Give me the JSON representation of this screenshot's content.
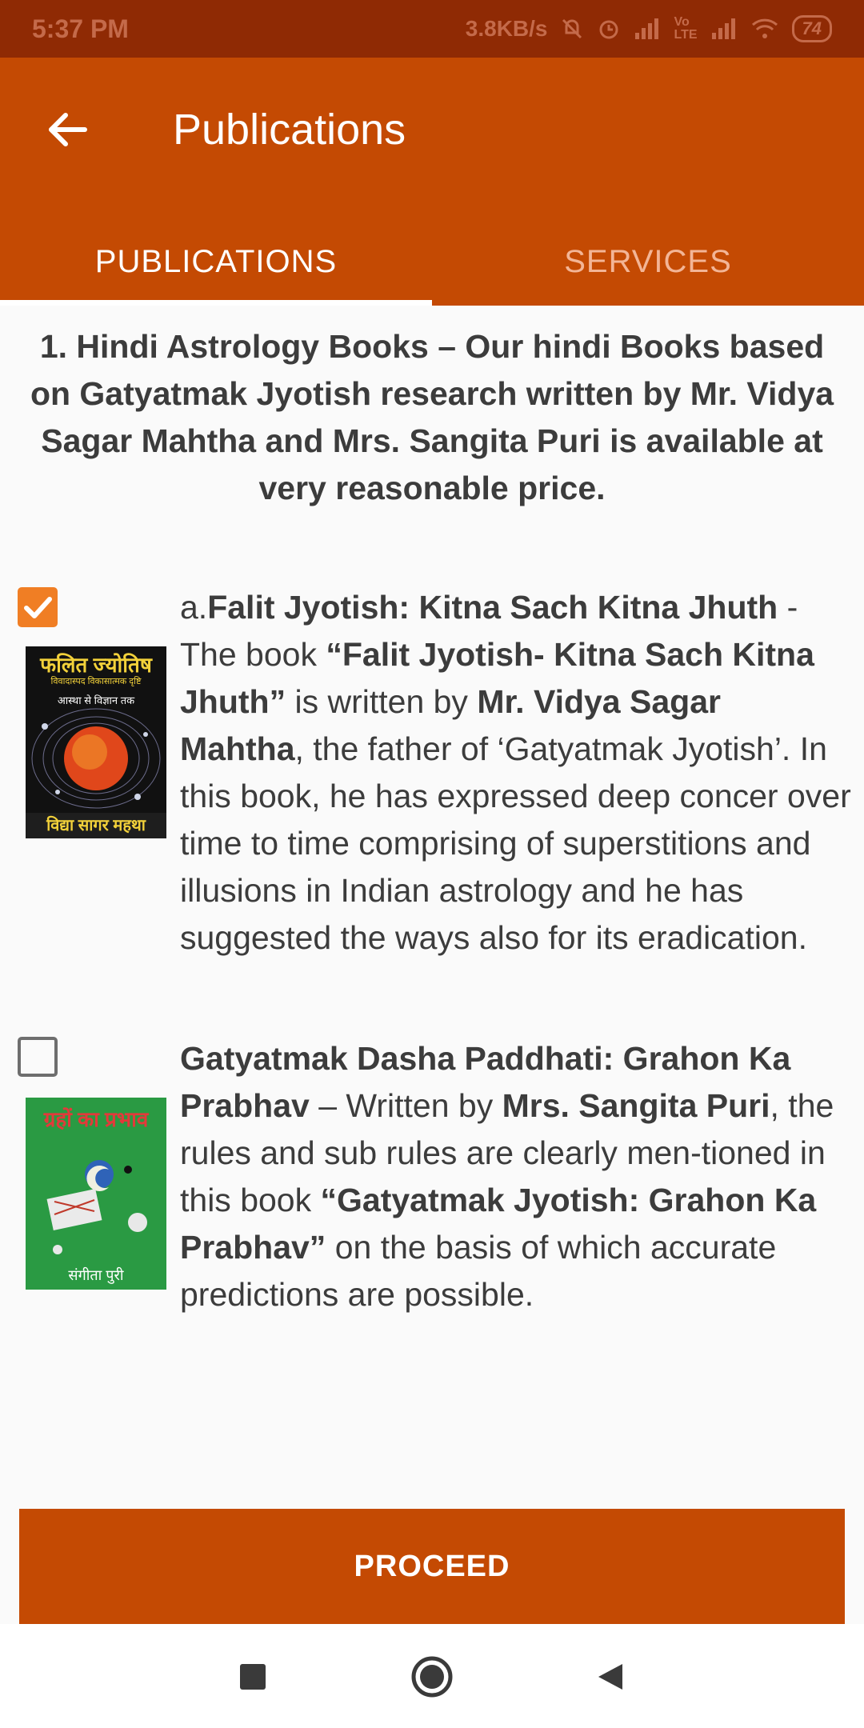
{
  "status_bar": {
    "time": "5:37 PM",
    "net_speed": "3.8KB/s",
    "battery": "74",
    "icons": [
      "mute-icon",
      "alarm-icon",
      "signal-icon",
      "volte-icon",
      "signal-icon",
      "wifi-icon",
      "battery-icon"
    ]
  },
  "app_bar": {
    "title": "Publications",
    "back_icon": "arrow-back-icon"
  },
  "tabs": [
    {
      "label": "PUBLICATIONS",
      "active": true
    },
    {
      "label": "SERVICES",
      "active": false
    }
  ],
  "intro": "1. Hindi Astrology Books – Our hindi Books based on Gatyatmak Jyotish research written by Mr. Vidya Sagar Mahtha and Mrs. Sangita Puri is available at very reasonable price.",
  "books": [
    {
      "checked": true,
      "cover": {
        "title": "फलित ज्योतिष",
        "subtitle": "विवादास्पद विकासात्मक दृष्टि",
        "tagline": "आस्था से विज्ञान तक",
        "author": "विद्या सागर महथा"
      },
      "prefix": "a.",
      "title": "Falit Jyotish: Kitna Sach Kitna Jhuth",
      "t1": " - The book ",
      "quote": "“Falit Jyotish- Kitna Sach Kitna Jhuth”",
      "t2": " is written by ",
      "author": "Mr. Vidya Sagar Mahtha",
      "t3": ", the father of ‘Gatyatmak Jyotish’. In this book, he has expressed deep concer over time to time comprising of superstitions and illusions in Indian astrology and he has suggested the ways also for its eradication."
    },
    {
      "checked": false,
      "cover": {
        "title": "ग्रहों का प्रभाव",
        "author": "संगीता पुरी"
      },
      "title": "Gatyatmak Dasha Paddhati: Grahon Ka Prabhav",
      "t1": " – Written by ",
      "author": "Mrs. Sangita Puri",
      "t2": ", the rules and sub rules are clearly men-tioned in this book ",
      "quote": "“Gatyatmak Jyotish: Grahon Ka Prabhav”",
      "t3": " on the basis of which accurate predictions are possible."
    }
  ],
  "proceed_label": "PROCEED",
  "nav": [
    "recent-apps-icon",
    "home-icon",
    "back-icon"
  ],
  "colors": {
    "primary": "#c44a03",
    "status_bar": "#8f2a04",
    "checkbox_checked": "#f07e24",
    "text": "#3c3c3c"
  }
}
